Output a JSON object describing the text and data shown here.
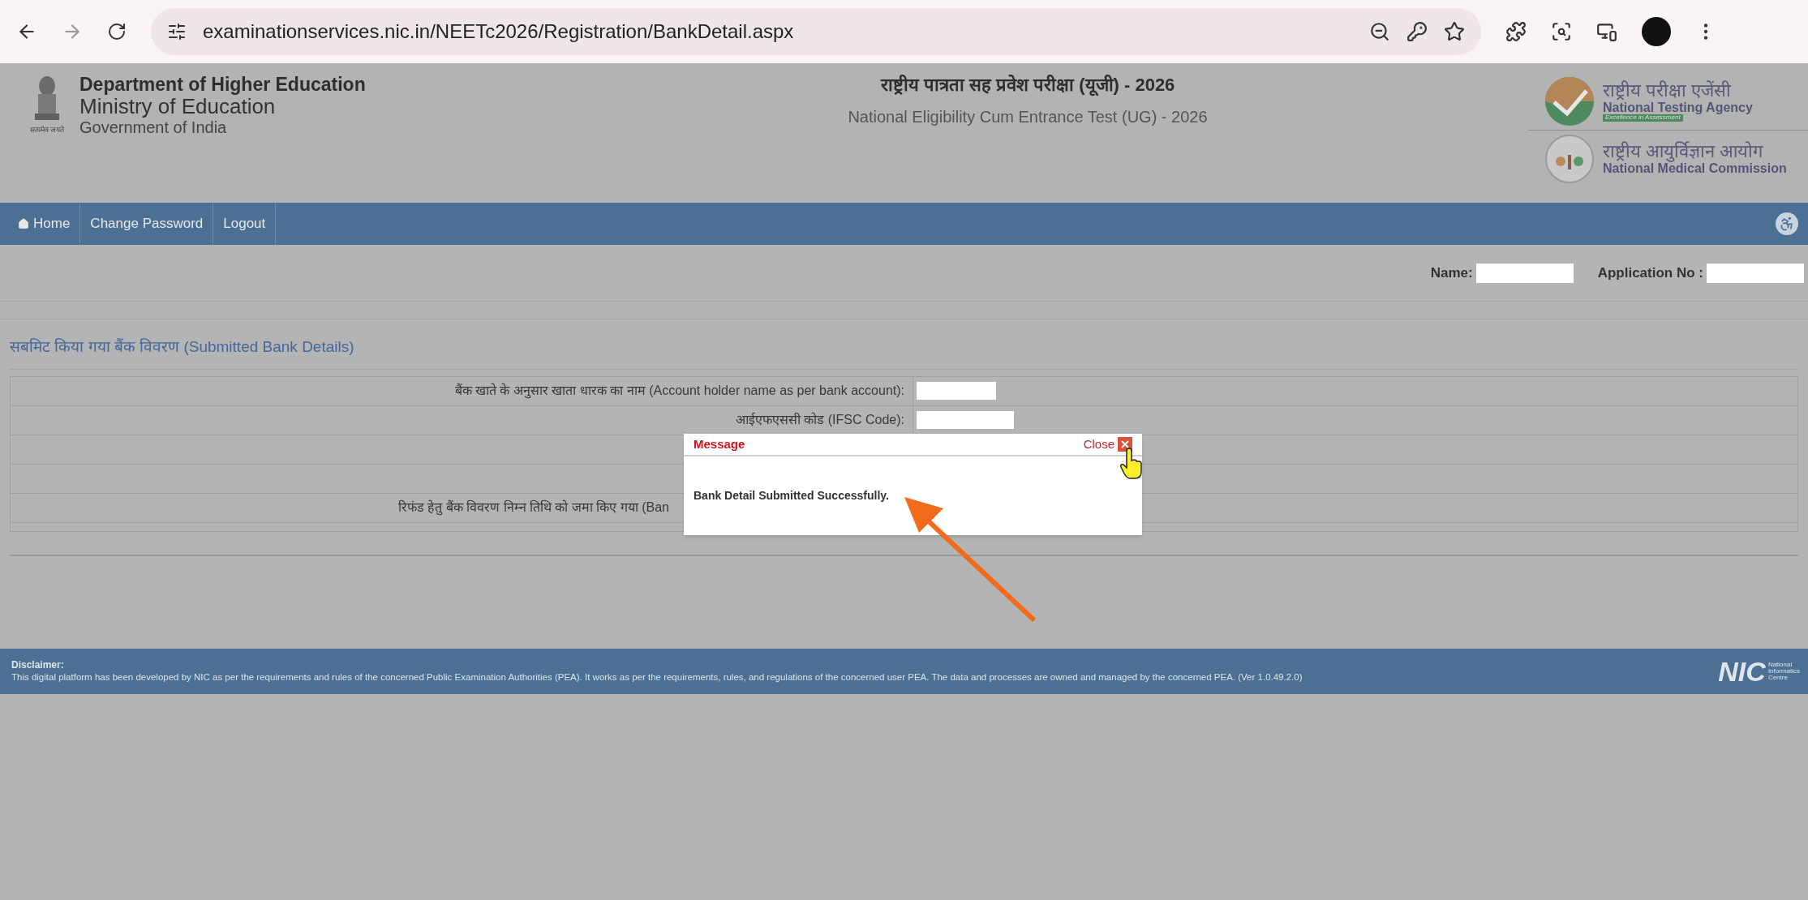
{
  "browser": {
    "url": "examinationservices.nic.in/NEETc2026/Registration/BankDetail.aspx"
  },
  "header": {
    "emblem_motto": "सत्यमेव जयते",
    "department": "Department of Higher Education",
    "ministry": "Ministry of Education",
    "government": "Government of India",
    "exam_title_hi": "राष्ट्रीय पात्रता सह प्रवेश परीक्षा (यूजी) - 2026",
    "exam_title_en": "National Eligibility Cum Entrance Test (UG) - 2026",
    "nta": {
      "name_hi": "राष्ट्रीय परीक्षा एजेंसी",
      "name_en": "National Testing Agency",
      "tagline": "Excellence in Assessment"
    },
    "nmc": {
      "name_hi": "राष्ट्रीय आयुर्विज्ञान आयोग",
      "name_en": "National Medical Commission"
    }
  },
  "nav": [
    {
      "label": "Home",
      "kind": "home"
    },
    {
      "label": "Change Password",
      "kind": "text"
    },
    {
      "label": "Logout",
      "kind": "text"
    }
  ],
  "user_info": [
    {
      "label": "Name:"
    },
    {
      "label": "Application No :"
    }
  ],
  "section_title": "सबमिट किया गया बैंक विवरण (Submitted Bank Details)",
  "rows": [
    {
      "kind": "value",
      "label": "बैंक खाते के अनुसार खाता धारक का नाम (Account holder name as per bank account):"
    },
    {
      "kind": "value",
      "label": "आईएफएससी कोड (IFSC Code):"
    },
    {
      "kind": "empty"
    },
    {
      "kind": "empty"
    },
    {
      "kind": "covered",
      "label": "रिफंड हेतु बैंक विवरण निम्न तिथि को जमा किए गया (Ban"
    }
  ],
  "dialog": {
    "title": "Message",
    "close": "Close",
    "message": "Bank Detail Submitted Successfully."
  },
  "footer": {
    "heading": "Disclaimer:",
    "text": "This digital platform has been developed by NIC as per the requirements and rules of the concerned Public Examination Authorities (PEA). It works as per the requirements, rules, and regulations of the concerned user PEA. The data and processes are owned and managed by the concerned PEA. (Ver 1.0.49.2.0)",
    "nic_mark": "NIC",
    "nic_lines": [
      "National",
      "Informatics",
      "Centre"
    ]
  }
}
